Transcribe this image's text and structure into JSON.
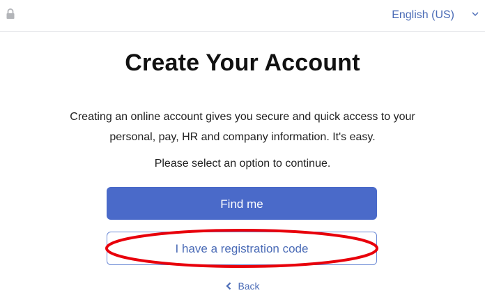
{
  "header": {
    "lock_icon": "lock-icon",
    "language": "English (US)",
    "language_dropdown_icon": "chevron-down-icon"
  },
  "main": {
    "title": "Create Your Account",
    "intro_line1": "Creating an online account gives you secure and quick access to your",
    "intro_line2": "personal, pay, HR and company information. It's easy.",
    "prompt": "Please select an option to continue.",
    "find_me_label": "Find me",
    "registration_code_label": "I have a registration code",
    "back_label": "Back",
    "back_icon": "chevron-left-icon"
  },
  "annotation": {
    "highlight_color": "#e8000b"
  },
  "colors": {
    "primary": "#4a6ac9",
    "link": "#4a6bb6",
    "divider": "#e2e4e8"
  }
}
